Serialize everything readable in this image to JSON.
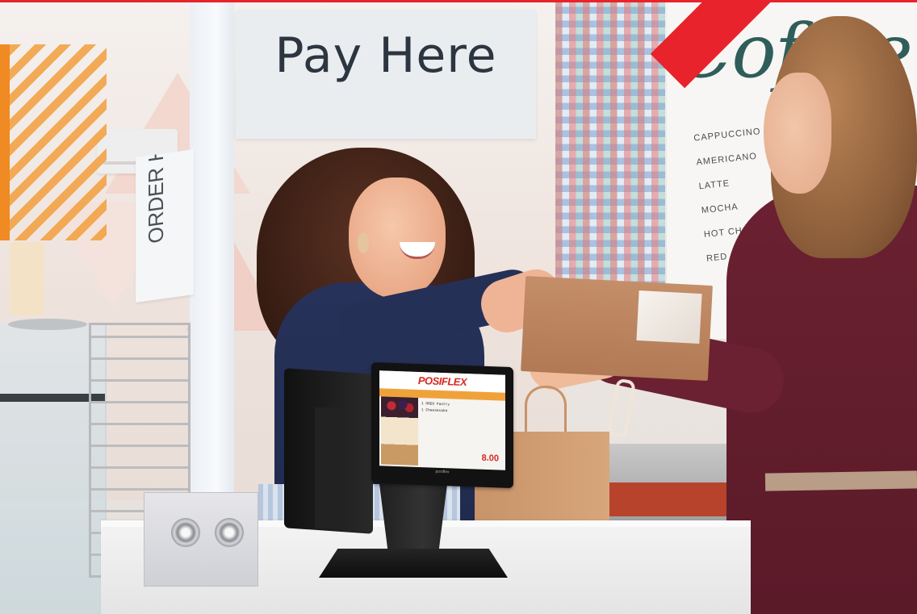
{
  "signs": {
    "pay_here": "Pay Here",
    "order_here": "ORDER HERE"
  },
  "menu_board": {
    "script_title": "Coffee",
    "items": [
      "CAPPUCCINO",
      "AMERICANO",
      "LATTE",
      "MOCHA",
      "HOT CHOC",
      "RED CA"
    ]
  },
  "pos": {
    "logo": "POSIFLEX",
    "line_items": [
      "1  OREO Pastry",
      "1  Cheesecake"
    ],
    "total": "8.00",
    "brand_mark": "posiflex"
  },
  "colors": {
    "accent_red": "#e8232b",
    "accent_orange": "#f08a23"
  }
}
